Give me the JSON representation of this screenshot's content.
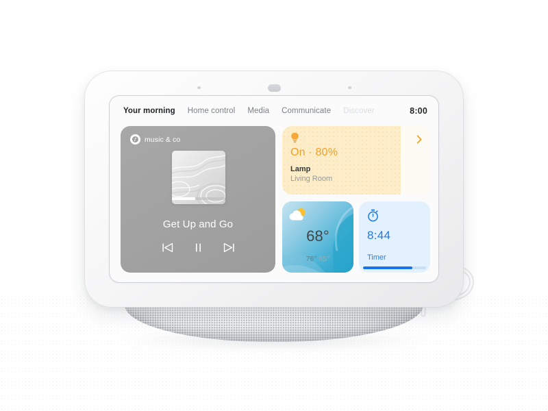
{
  "device": {
    "name": "smart-display",
    "sensors": [
      "proximity-sensor-left",
      "ambient-light-sensor",
      "proximity-sensor-right"
    ]
  },
  "screen": {
    "tabs": [
      {
        "label": "Your morning",
        "state": "active"
      },
      {
        "label": "Home control",
        "state": "inactive"
      },
      {
        "label": "Media",
        "state": "inactive"
      },
      {
        "label": "Communicate",
        "state": "inactive"
      },
      {
        "label": "Discover",
        "state": "faded"
      }
    ],
    "clock": "8:00"
  },
  "cards": {
    "music": {
      "service_name": "music & co",
      "service_icon": "music-note-icon",
      "album_art": "album-art-water-ripples",
      "track_title": "Get Up and Go",
      "controls": {
        "previous": "previous-track-icon",
        "play_pause": "pause-icon",
        "next": "next-track-icon"
      }
    },
    "lamp": {
      "icon": "lightbulb-icon",
      "state_text": "On · 80%",
      "brightness_percent": 80,
      "name": "Lamp",
      "room": "Living Room",
      "chevron": "chevron-right-icon",
      "accent_color": "#f0a028",
      "fill_color": "#fdeec9"
    },
    "weather": {
      "icon": "partly-cloudy-icon",
      "temperature": "68°",
      "high": "76°",
      "low": "65°"
    },
    "timer": {
      "icon": "stopwatch-icon",
      "time_remaining": "8:44",
      "label": "Timer",
      "progress_percent": 78,
      "accent_color": "#1a73e8"
    }
  }
}
